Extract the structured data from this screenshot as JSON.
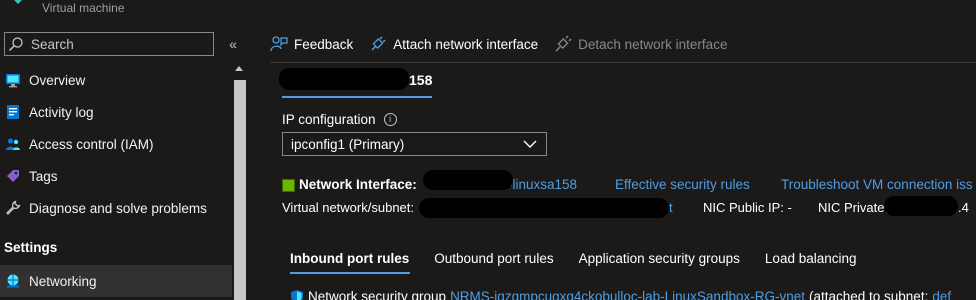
{
  "resource": {
    "subtitle": "Virtual machine"
  },
  "search": {
    "placeholder": "Search",
    "collapse_glyph": "«"
  },
  "nav": {
    "items": [
      {
        "label": "Overview",
        "icon": "monitor-icon"
      },
      {
        "label": "Activity log",
        "icon": "activity-log-icon"
      },
      {
        "label": "Access control (IAM)",
        "icon": "people-icon"
      },
      {
        "label": "Tags",
        "icon": "tag-icon"
      },
      {
        "label": "Diagnose and solve problems",
        "icon": "wrench-icon"
      }
    ],
    "settings_heading": "Settings",
    "settings_items": [
      {
        "label": "Networking",
        "icon": "networking-icon",
        "active": true
      }
    ]
  },
  "toolbar": {
    "feedback": "Feedback",
    "attach": "Attach network interface",
    "detach": "Detach network interface"
  },
  "nic_tab": {
    "visible_suffix": "158"
  },
  "ip_configuration": {
    "label": "IP configuration",
    "info_glyph": "i",
    "selected": "ipconfig1 (Primary)"
  },
  "nic": {
    "label": "Network Interface:",
    "name_visible_suffix": "-linuxsa158",
    "effective_rules": "Effective security rules",
    "troubleshoot": "Troubleshoot VM connection iss"
  },
  "subnet": {
    "label": "Virtual network/subnet:",
    "link_suffix": "t",
    "public_ip": "NIC Public IP: -",
    "private_ip_label": "NIC Private",
    "private_ip_suffix": ".4"
  },
  "rule_tabs": [
    {
      "label": "Inbound port rules",
      "active": true
    },
    {
      "label": "Outbound port rules",
      "active": false
    },
    {
      "label": "Application security groups",
      "active": false
    },
    {
      "label": "Load balancing",
      "active": false
    }
  ],
  "nsg": {
    "prefix": "Network security group",
    "name": "NRMS-jgzqmpcugxq4ckobulloc-lab-LinuxSandbox-RG-vnet",
    "attached": "(attached to subnet:",
    "subnet_link": "def"
  },
  "colors": {
    "background": "#1b1a19",
    "link": "#4f9ee3",
    "text": "#ffffff",
    "muted": "#8a8886",
    "active_nav": "#323130"
  }
}
